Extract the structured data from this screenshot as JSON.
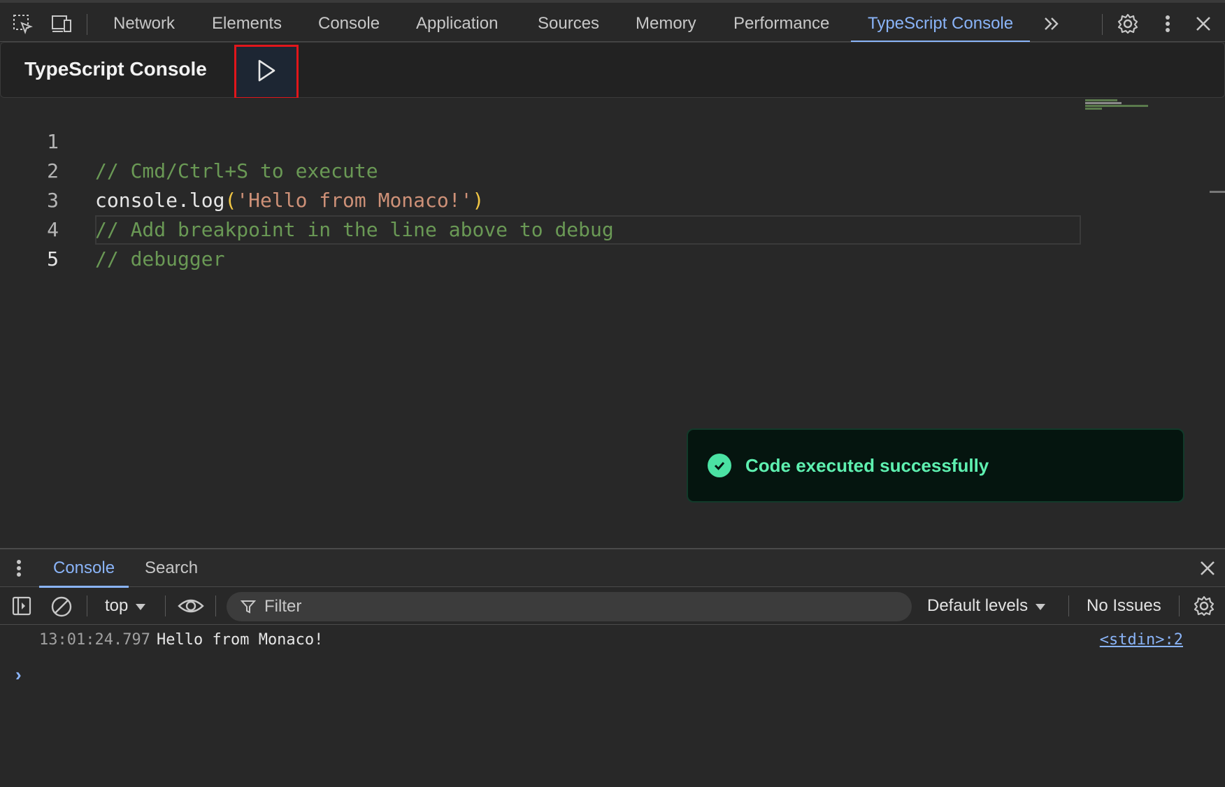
{
  "topbar": {
    "tabs": [
      "Network",
      "Elements",
      "Console",
      "Application",
      "Sources",
      "Memory",
      "Performance",
      "TypeScript Console"
    ],
    "active_tab": "TypeScript Console",
    "icons": [
      "inspect-element-icon",
      "device-toolbar-icon",
      "more-tabs-icon",
      "settings-gear-icon",
      "more-options-icon",
      "close-icon"
    ]
  },
  "ts_console": {
    "title": "TypeScript Console",
    "run_icon": "play-icon"
  },
  "editor": {
    "lines": [
      {
        "num": "1",
        "text": "// Cmd/Ctrl+S to execute"
      },
      {
        "num": "2",
        "pre": "console.log",
        "open": "(",
        "str": "'Hello from Monaco!'",
        "close": ")"
      },
      {
        "num": "3",
        "text": "// Add breakpoint in the line above to debug"
      },
      {
        "num": "4",
        "text": "// debugger"
      },
      {
        "num": "5",
        "text": ""
      }
    ]
  },
  "toast": {
    "message": "Code executed successfully",
    "icon": "check-circle-icon"
  },
  "drawer": {
    "tabs": [
      "Console",
      "Search"
    ],
    "active_tab": "Console",
    "toolbar": {
      "context": "top",
      "filter_placeholder": "Filter",
      "levels": "Default levels",
      "issues": "No Issues"
    },
    "log": {
      "timestamp": "13:01:24.797",
      "message": "Hello from Monaco!",
      "source": "<stdin>:2"
    },
    "prompt": "›"
  },
  "colors": {
    "accent": "#8ab4f8",
    "comment": "#6a9955",
    "string": "#ce9178",
    "success": "#4be2a3",
    "highlight": "#e0161b"
  }
}
